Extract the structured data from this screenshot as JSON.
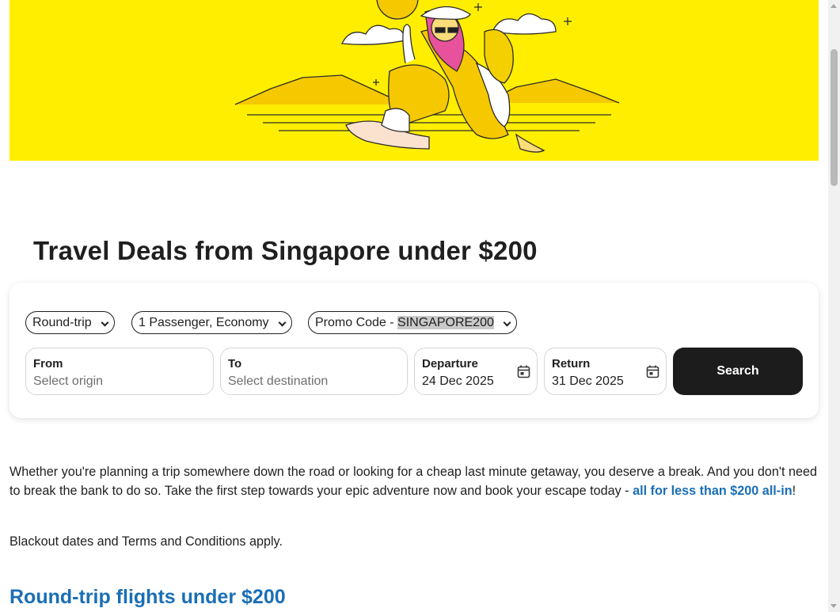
{
  "colors": {
    "hero_bg": "#ffee00",
    "link": "#1a6fb5",
    "button_bg": "#1c1c1c"
  },
  "page_title": "Travel Deals from Singapore under $200",
  "search": {
    "trip_type": "Round-trip",
    "passengers": "1 Passenger, Economy",
    "promo_prefix": "Promo Code - ",
    "promo_code": "SINGAPORE200",
    "from_label": "From",
    "from_placeholder": "Select origin",
    "to_label": "To",
    "to_placeholder": "Select destination",
    "departure_label": "Departure",
    "departure_value": "24 Dec 2025",
    "return_label": "Return",
    "return_value": "31 Dec 2025",
    "search_button": "Search"
  },
  "intro": {
    "text": "Whether you're planning a trip somewhere down the road or looking for a cheap last minute getaway, you deserve a break. And you don't need to break the bank to do so. Take the first step towards your epic adventure now and book your escape today - ",
    "link_text": "all for less than $200 all-in",
    "suffix": "!"
  },
  "terms_note": "Blackout dates and Terms and Conditions apply.",
  "section_heading": "Round-trip flights under $200"
}
